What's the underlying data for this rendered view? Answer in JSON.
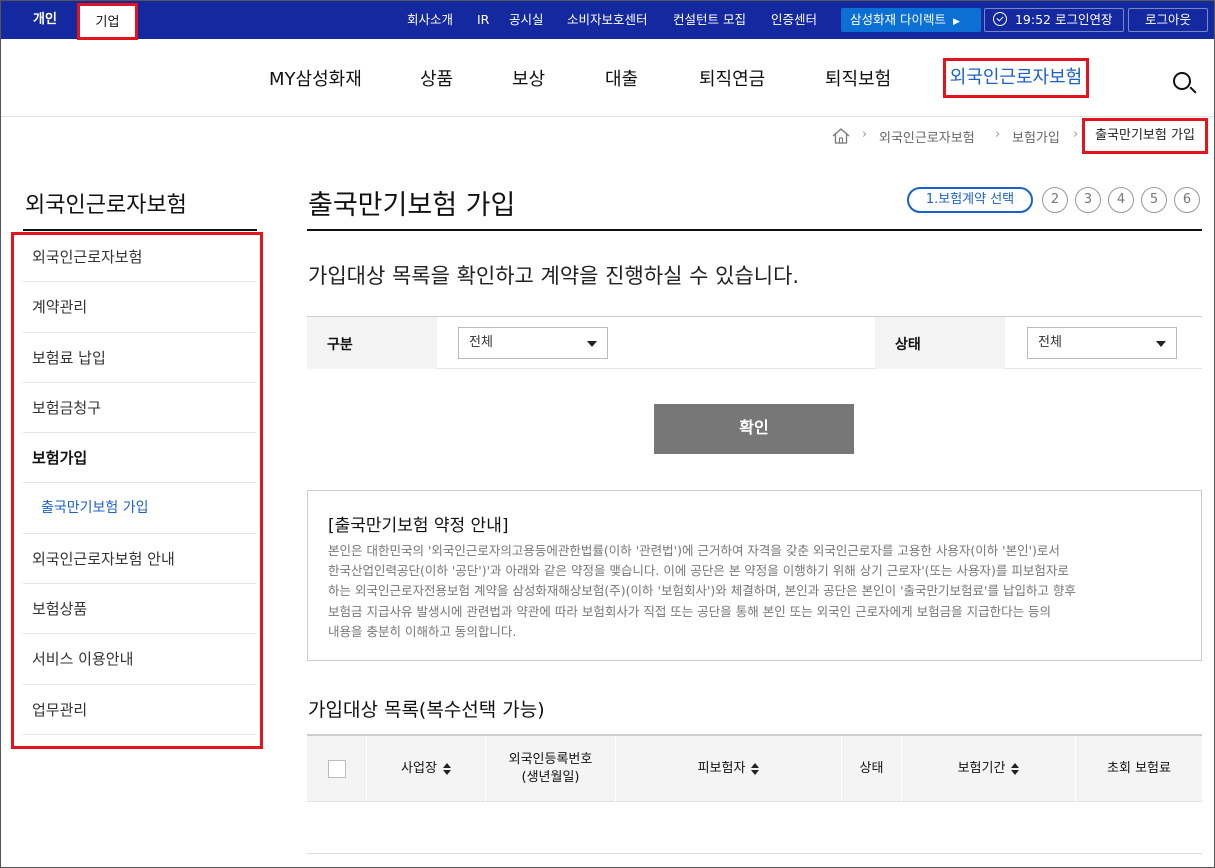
{
  "topbar": {
    "personal": "개인",
    "corporate": "기업",
    "links": [
      "회사소개",
      "IR",
      "공시실",
      "소비자보호센터",
      "컨설턴트 모집",
      "인증센터"
    ],
    "direct": "삼성화재 다이렉트",
    "session_time": "19:52",
    "extend_label": "로그인연장",
    "logout": "로그아웃"
  },
  "nav": {
    "items": [
      "MY삼성화재",
      "상품",
      "보상",
      "대출",
      "퇴직연금",
      "퇴직보험"
    ],
    "active": "외국인근로자보험"
  },
  "breadcrumb": {
    "items": [
      "외국인근로자보험",
      "보험가입"
    ],
    "current": "출국만기보험 가입"
  },
  "sidebar": {
    "title": "외국인근로자보험",
    "items": [
      {
        "label": "외국인근로자보험"
      },
      {
        "label": "계약관리"
      },
      {
        "label": "보험료 납입"
      },
      {
        "label": "보험금청구"
      },
      {
        "label": "보험가입"
      },
      {
        "label": "출국만기보험 가입"
      },
      {
        "label": "외국인근로자보험 안내"
      },
      {
        "label": "보험상품"
      },
      {
        "label": "서비스 이용안내"
      },
      {
        "label": "업무관리"
      }
    ]
  },
  "page": {
    "title": "출국만기보험 가입",
    "steps": {
      "active": "1.보험계약 선택",
      "others": [
        "2",
        "3",
        "4",
        "5",
        "6"
      ]
    },
    "intro": "가입대상 목록을 확인하고 계약을 진행하실 수 있습니다."
  },
  "filter": {
    "category_label": "구분",
    "category_value": "전체",
    "status_label": "상태",
    "status_value": "전체",
    "confirm": "확인"
  },
  "notice": {
    "title": "[출국만기보험 약정 안내]",
    "lines": [
      "본인은 대한민국의 '외국인근로자의고용등에관한법률(이하 '관련법')에 근거하여 자격을 갖춘 외국인근로자를 고용한 사용자(이하 '본인')로서",
      "한국산업인력공단(이하 '공단')'과 아래와 같은 약정을 맺습니다. 이에 공단은 본 약정을 이행하기 위해 상기 근로자'(또는 사용자)를 피보험자로",
      "하는 외국인근로자전용보험 계약을 삼성화재해상보험(주)(이하 '보험회사')와 체결하며, 본인과 공단은 본인이 '출국만기보험료'를 납입하고 향후",
      "보험금 지급사유 발생시에 관련법과 약관에 따라 보험회사가 직접 또는 공단을 통해 본인 또는 외국인 근로자에게 보험금을 지급한다는 등의",
      "내용을 충분히 이해하고 동의합니다."
    ]
  },
  "list": {
    "title": "가입대상 목록(복수선택 가능)",
    "columns": {
      "workplace": "사업장",
      "reg_no": "외국인등록번호",
      "reg_no_sub": "(생년월일)",
      "insured": "피보험자",
      "status": "상태",
      "period": "보험기간",
      "premium": "초회 보험료"
    }
  }
}
